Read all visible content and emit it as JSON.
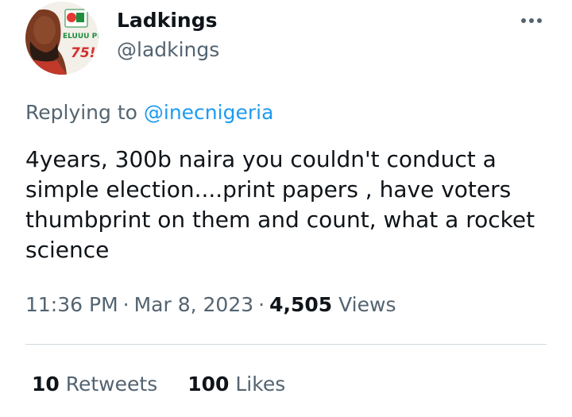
{
  "author": {
    "display_name": "Ladkings",
    "handle": "@ladkings",
    "avatar_badge_text": "ELUUU P!",
    "avatar_number": "75!"
  },
  "reply": {
    "prefix": "Replying to ",
    "mention": "@inecnigeria"
  },
  "tweet": {
    "text": "4years, 300b naira you couldn't conduct a simple election....print papers , have voters thumbprint on them and count, what a rocket science"
  },
  "meta": {
    "time": "11:36 PM",
    "separator": "·",
    "date": "Mar 8, 2023",
    "views_count": "4,505",
    "views_label": "Views"
  },
  "stats": {
    "retweets_count": "10",
    "retweets_label": "Retweets",
    "likes_count": "100",
    "likes_label": "Likes"
  },
  "icons": {
    "more": "more-horizontal-icon"
  },
  "colors": {
    "primary_text": "#0f1419",
    "secondary_text": "#536471",
    "link": "#1d9bf0",
    "divider": "#cfd9de"
  }
}
